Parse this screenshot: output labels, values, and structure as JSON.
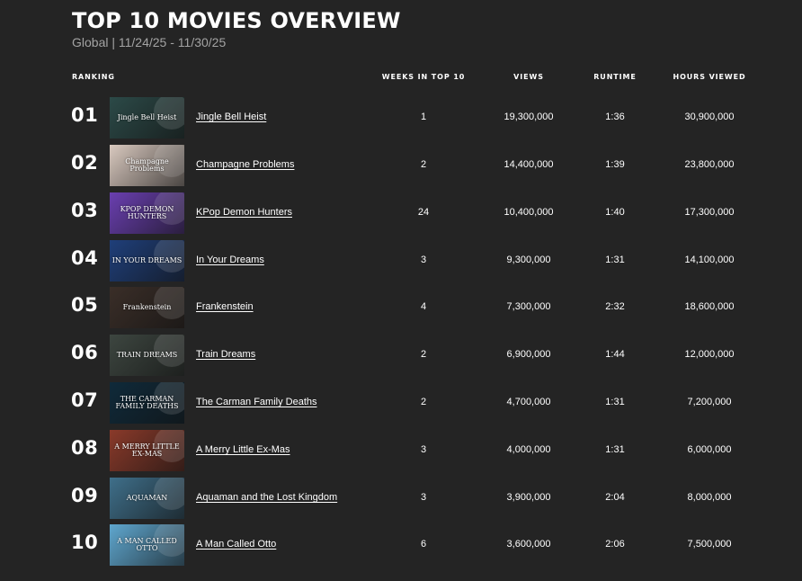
{
  "header": {
    "title": "TOP 10 MOVIES OVERVIEW",
    "subtitle": "Global | 11/24/25 - 11/30/25"
  },
  "columns": {
    "ranking": "RANKING",
    "weeks": "WEEKS IN TOP 10",
    "views": "VIEWS",
    "runtime": "RUNTIME",
    "hours": "HOURS VIEWED"
  },
  "rows": [
    {
      "rank": "01",
      "title": "Jingle Bell Heist",
      "weeks": "1",
      "views": "19,300,000",
      "runtime": "1:36",
      "hours": "30,900,000",
      "thumb_text": "Jingle Bell Heist"
    },
    {
      "rank": "02",
      "title": "Champagne Problems",
      "weeks": "2",
      "views": "14,400,000",
      "runtime": "1:39",
      "hours": "23,800,000",
      "thumb_text": "Champagne Problems"
    },
    {
      "rank": "03",
      "title": "KPop Demon Hunters",
      "weeks": "24",
      "views": "10,400,000",
      "runtime": "1:40",
      "hours": "17,300,000",
      "thumb_text": "KPOP DEMON HUNTERS"
    },
    {
      "rank": "04",
      "title": "In Your Dreams",
      "weeks": "3",
      "views": "9,300,000",
      "runtime": "1:31",
      "hours": "14,100,000",
      "thumb_text": "IN YOUR DREAMS"
    },
    {
      "rank": "05",
      "title": "Frankenstein",
      "weeks": "4",
      "views": "7,300,000",
      "runtime": "2:32",
      "hours": "18,600,000",
      "thumb_text": "Frankenstein"
    },
    {
      "rank": "06",
      "title": "Train Dreams",
      "weeks": "2",
      "views": "6,900,000",
      "runtime": "1:44",
      "hours": "12,000,000",
      "thumb_text": "TRAIN DREAMS"
    },
    {
      "rank": "07",
      "title": "The Carman Family Deaths",
      "weeks": "2",
      "views": "4,700,000",
      "runtime": "1:31",
      "hours": "7,200,000",
      "thumb_text": "THE CARMAN FAMILY DEATHS"
    },
    {
      "rank": "08",
      "title": "A Merry Little Ex-Mas",
      "weeks": "3",
      "views": "4,000,000",
      "runtime": "1:31",
      "hours": "6,000,000",
      "thumb_text": "A MERRY LITTLE EX-MAS"
    },
    {
      "rank": "09",
      "title": "Aquaman and the Lost Kingdom",
      "weeks": "3",
      "views": "3,900,000",
      "runtime": "2:04",
      "hours": "8,000,000",
      "thumb_text": "AQUAMAN"
    },
    {
      "rank": "10",
      "title": "A Man Called Otto",
      "weeks": "6",
      "views": "3,600,000",
      "runtime": "2:06",
      "hours": "7,500,000",
      "thumb_text": "A MAN CALLED OTTO"
    }
  ],
  "thumbnail_colors": [
    "#2c4a48",
    "#d9c9bf",
    "#6a3fb0",
    "#1f3f7a",
    "#3a2e28",
    "#3d4640",
    "#0f2a3a",
    "#8a3a2a",
    "#3f6f8a",
    "#5fa7cf"
  ]
}
